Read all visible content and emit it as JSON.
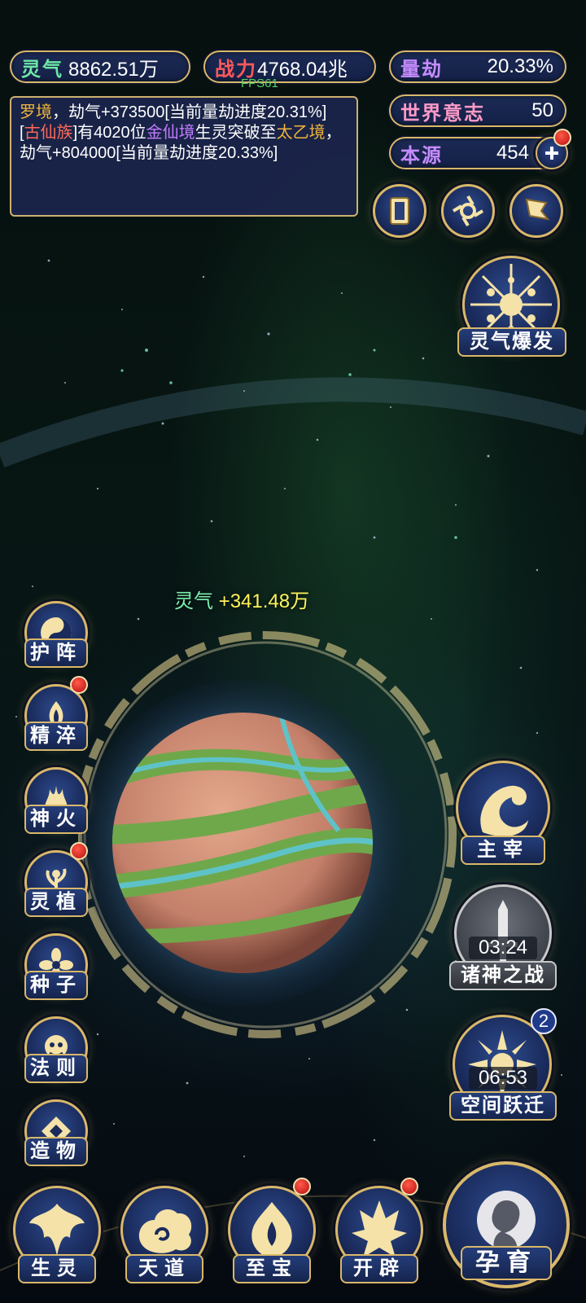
{
  "stats": {
    "lingqi": {
      "label": "灵气",
      "value": "8862.51万"
    },
    "zhanli": {
      "label": "战力",
      "value": "4768.04兆"
    },
    "liangjie": {
      "label": "量劫",
      "value": "20.33%"
    },
    "world_will": {
      "label": "世界意志",
      "value": "50"
    },
    "benyuan": {
      "label": "本源",
      "value": "454"
    }
  },
  "fps": "FPS61",
  "log": {
    "line1": {
      "realm": "罗境",
      "text": "，劫气+373500[当前量劫进度20.31%]"
    },
    "line2": {
      "open": "[",
      "clan": "古仙族",
      "mid1": "]有4020位",
      "realm1": "金仙境",
      "mid2": "生灵突破至",
      "realm2": "太乙境",
      "end": "，劫气+804000[当前量劫进度20.33%]"
    }
  },
  "burst_button": {
    "label": "灵气爆发"
  },
  "gain_text": {
    "key": "灵气",
    "value": "+341.48万"
  },
  "side_left": [
    {
      "label": "护阵",
      "icon": "yin-yang-icon"
    },
    {
      "label": "精淬",
      "icon": "flame-lotus-icon",
      "alert": true
    },
    {
      "label": "神火",
      "icon": "divine-fire-icon"
    },
    {
      "label": "灵植",
      "icon": "spirit-plant-icon",
      "alert": true
    },
    {
      "label": "种子",
      "icon": "seed-flower-icon"
    },
    {
      "label": "法则",
      "icon": "law-beast-icon"
    },
    {
      "label": "造物",
      "icon": "creation-diamond-icon"
    }
  ],
  "side_right": {
    "master": {
      "label": "主宰",
      "icon": "dragon-icon"
    },
    "gods_war": {
      "label": "诸神之战",
      "timer": "03:24",
      "icon": "sword-icon"
    },
    "space_jump": {
      "label": "空间跃迁",
      "timer": "06:53",
      "badge": "2",
      "icon": "sun-portal-icon"
    }
  },
  "bottom_nav": [
    {
      "label": "生灵",
      "icon": "phoenix-icon"
    },
    {
      "label": "天道",
      "icon": "cloud-swirl-icon"
    },
    {
      "label": "至宝",
      "icon": "treasure-icon",
      "alert": true
    },
    {
      "label": "开辟",
      "icon": "axe-flame-icon",
      "alert": true
    }
  ],
  "nurture_button": {
    "label": "孕育",
    "icon": "figure-icon"
  },
  "colors": {
    "gold": "#d9b86a",
    "panel": "#1b2a55",
    "planet": "#c98a6e",
    "vegetation": "#6fa84a",
    "water": "#5ec3c8"
  }
}
